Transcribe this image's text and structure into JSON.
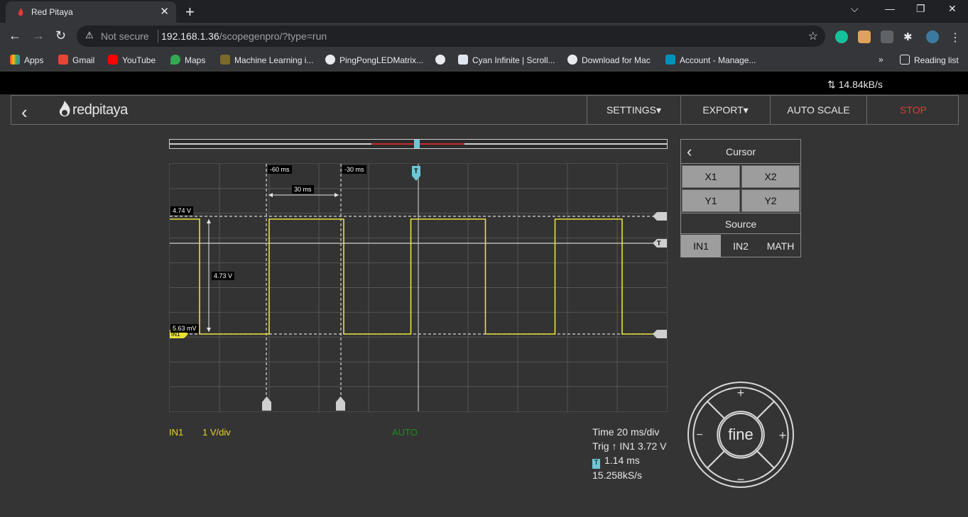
{
  "browser": {
    "tab_title": "Red Pitaya",
    "new_tab": "+",
    "not_secure": "Not secure",
    "url_host": "192.168.1.36",
    "url_path": "/scopegenpro/?type=run",
    "bookmarks": [
      "Apps",
      "Gmail",
      "YouTube",
      "Maps",
      "Machine Learning i...",
      "PingPongLEDMatrix...",
      "",
      "Cyan Infinite | Scroll...",
      "Download for Mac",
      "Account - Manage..."
    ],
    "more_bookmarks": "»",
    "reading_list": "Reading list"
  },
  "status": {
    "speed": "14.84kB/s"
  },
  "header": {
    "logo": "redpitaya",
    "buttons": [
      "SETTINGS▾",
      "EXPORT▾",
      "AUTO SCALE",
      "STOP"
    ]
  },
  "scope": {
    "labels": {
      "cursor_x1": "-60 ms",
      "cursor_x2": "-30 ms",
      "delta_x": "30 ms",
      "y_high": "4.74 V",
      "y_low": "5.63 mV",
      "delta_y": "4.73 V",
      "in1_marker": "IN1",
      "trig_marker": "T",
      "trig_top": "T"
    },
    "channel": "IN1",
    "scale": "1 V/div",
    "mode": "AUTO",
    "time": "Time 20 ms/div",
    "trig": "Trig ↑ IN1 3.72 V",
    "trig_delay": "1.14 ms",
    "trig_badge": "T",
    "sample_rate": "15.258kS/s",
    "colors": {
      "trace": "#e8e03a",
      "trigger": "#6ec6d6",
      "stop": "#e23b3b"
    },
    "waveform": {
      "period_ms": 42,
      "high_v": 4.74,
      "low_v": 0.00563
    }
  },
  "cursor_panel": {
    "title": "Cursor",
    "buttons": [
      "X1",
      "X2",
      "Y1",
      "Y2"
    ],
    "source_title": "Source",
    "sources": [
      "IN1",
      "IN2",
      "MATH"
    ],
    "active_source": "IN1"
  },
  "dial": {
    "label": "fine",
    "plus": "+",
    "minus": "−"
  }
}
